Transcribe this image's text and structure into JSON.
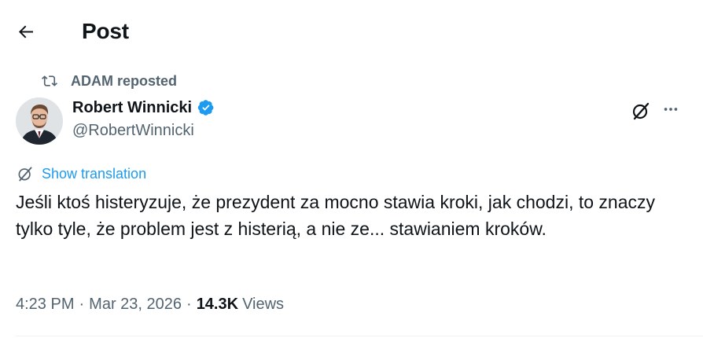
{
  "header": {
    "back_icon": "arrow-left-icon",
    "title": "Post"
  },
  "repost": {
    "icon": "repost-icon",
    "label": "ADAM reposted"
  },
  "author": {
    "name": "Robert Winnicki",
    "handle": "@RobertWinnicki",
    "verified_icon": "verified-badge-icon",
    "verified_color": "#1d9bf0"
  },
  "actions": {
    "grok_icon": "grok-icon",
    "more_icon": "more-horizontal-icon"
  },
  "translation": {
    "icon": "translate-icon",
    "label": "Show translation"
  },
  "tweet": {
    "text": "Jeśli ktoś histeryzuje, że prezydent za mocno stawia kroki, jak chodzi, to znaczy tylko tyle, że problem jest z histerią, a nie ze... stawianiem kroków."
  },
  "meta": {
    "time": "4:23 PM",
    "separator": "·",
    "date": "Mar 23, 2026",
    "views_count": "14.3K",
    "views_label": "Views"
  },
  "colors": {
    "accent": "#1d9bf0",
    "secondary_text": "#536471",
    "primary_text": "#0f1419"
  }
}
